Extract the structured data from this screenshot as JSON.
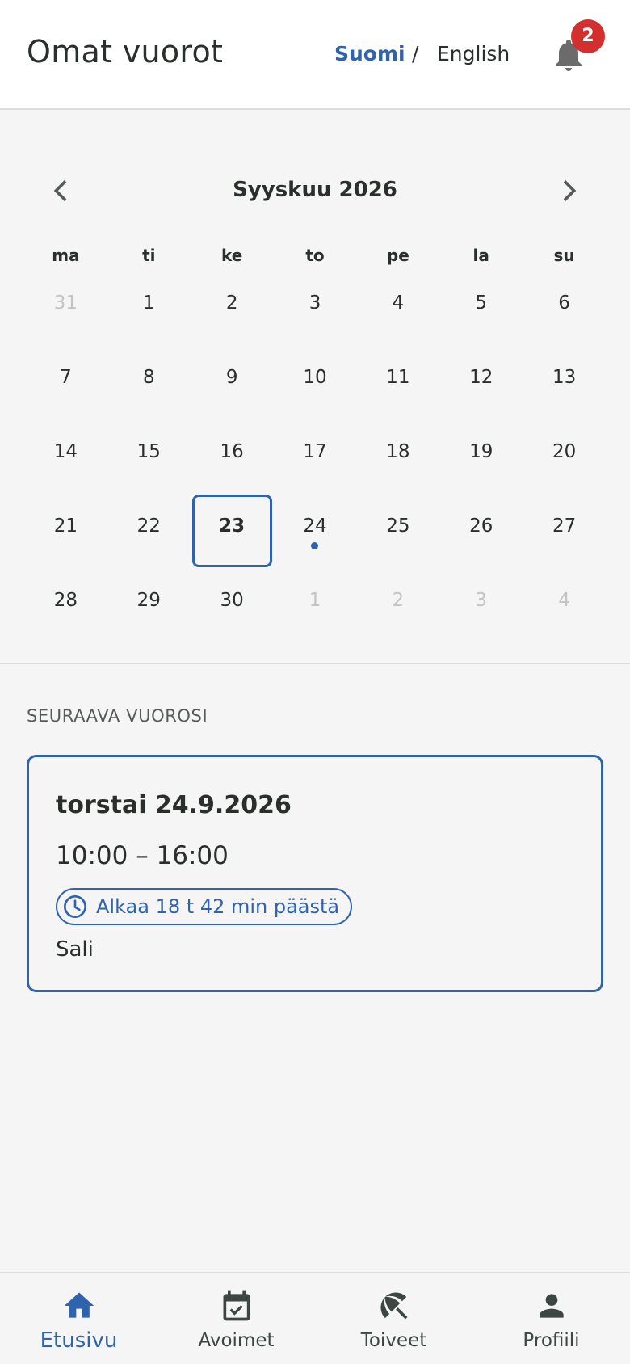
{
  "header": {
    "title": "Omat vuorot",
    "lang_fi": "Suomi",
    "lang_separator": "/",
    "lang_en": "English",
    "notification_count": "2"
  },
  "calendar": {
    "month_label": "Syyskuu 2026",
    "weekdays": [
      "ma",
      "ti",
      "ke",
      "to",
      "pe",
      "la",
      "su"
    ],
    "weeks": [
      [
        {
          "d": "31",
          "out": true
        },
        {
          "d": "1"
        },
        {
          "d": "2"
        },
        {
          "d": "3"
        },
        {
          "d": "4"
        },
        {
          "d": "5"
        },
        {
          "d": "6"
        }
      ],
      [
        {
          "d": "7"
        },
        {
          "d": "8"
        },
        {
          "d": "9"
        },
        {
          "d": "10"
        },
        {
          "d": "11"
        },
        {
          "d": "12"
        },
        {
          "d": "13"
        }
      ],
      [
        {
          "d": "14"
        },
        {
          "d": "15"
        },
        {
          "d": "16"
        },
        {
          "d": "17"
        },
        {
          "d": "18"
        },
        {
          "d": "19"
        },
        {
          "d": "20"
        }
      ],
      [
        {
          "d": "21"
        },
        {
          "d": "22"
        },
        {
          "d": "23",
          "today": true
        },
        {
          "d": "24",
          "shift": true
        },
        {
          "d": "25"
        },
        {
          "d": "26"
        },
        {
          "d": "27"
        }
      ],
      [
        {
          "d": "28"
        },
        {
          "d": "29"
        },
        {
          "d": "30"
        },
        {
          "d": "1",
          "out": true
        },
        {
          "d": "2",
          "out": true
        },
        {
          "d": "3",
          "out": true
        },
        {
          "d": "4",
          "out": true
        }
      ]
    ]
  },
  "next_shift": {
    "section_label": "SEURAAVA VUOROSI",
    "date": "torstai 24.9.2026",
    "time": "10:00 – 16:00",
    "starts_in": "Alkaa 18 t 42 min päästä",
    "location": "Sali"
  },
  "bottom_nav": {
    "items": [
      {
        "label": "Etusivu",
        "icon": "home-icon",
        "active": true
      },
      {
        "label": "Avoimet",
        "icon": "calendar-check-icon"
      },
      {
        "label": "Toiveet",
        "icon": "beach-umbrella-icon"
      },
      {
        "label": "Profiili",
        "icon": "person-icon"
      }
    ]
  },
  "colors": {
    "accent": "#2f63ad",
    "badge": "#d32f2f",
    "text": "#2a2f2c",
    "muted_day": "#c4c4c4"
  }
}
